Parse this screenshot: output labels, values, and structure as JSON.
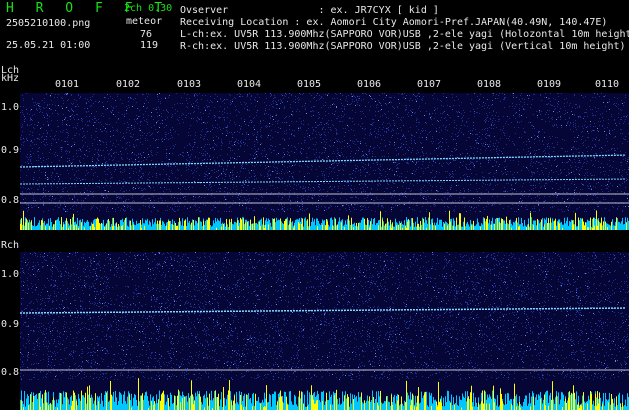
{
  "header": {
    "app_title": "H R O F F T",
    "version": "2ch 0.30",
    "mode": "meteor",
    "filename": "2505210100.png",
    "datetime": "25.05.21 01:00",
    "l_count": "76",
    "r_count": "119",
    "observer": "Ovserver               : ex. JR7CYX [ kid ]",
    "location": "Receiving Location : ex. Aomori City Aomori-Pref.JAPAN(40.49N, 140.47E)",
    "l_channel": "L-ch:ex. UV5R 113.900Mhz(SAPPORO VOR)USB ,2-ele yagi (Holozontal 10m height",
    "r_channel": "R-ch:ex. UV5R 113.900Mhz(SAPPORO VOR)USB ,2-ele yagi (Vertical 10m height)"
  },
  "time_ticks": [
    "0101",
    "0102",
    "0103",
    "0104",
    "0105",
    "0106",
    "0107",
    "0108",
    "0109",
    "0110"
  ],
  "lch": {
    "label": "Lch",
    "unit": "kHz",
    "ylabels": [
      "1.0",
      "0.9",
      "0.8"
    ]
  },
  "rch": {
    "label": "Rch",
    "ylabels": [
      "1.0",
      "0.9",
      "0.8"
    ]
  },
  "colors": {
    "background": "#000000",
    "panel": "#050536",
    "noise": "#2a3cb4",
    "carrier": "#7fd8ff",
    "bar_cyan": "#00c8ff",
    "bar_yellow": "#ffff00",
    "header_green": "#18e018"
  }
}
